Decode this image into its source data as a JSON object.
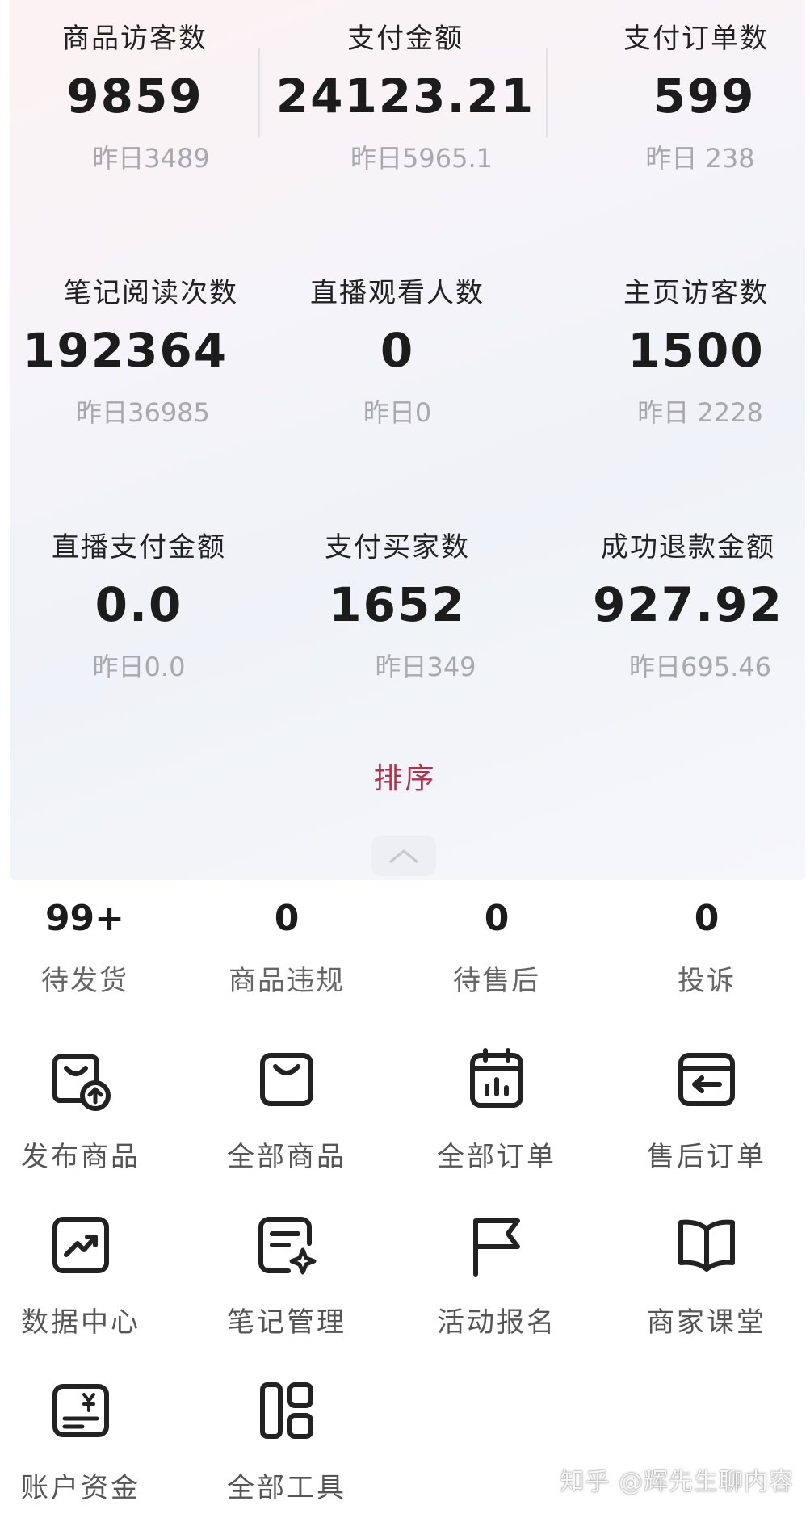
{
  "stats": [
    {
      "label": "商品访客数",
      "value": "9859",
      "yesterday": "昨日3489"
    },
    {
      "label": "支付金额",
      "value": "24123.21",
      "yesterday": "昨日5965.1"
    },
    {
      "label": "支付订单数",
      "value": "599",
      "yesterday": "昨日 238"
    },
    {
      "label": "笔记阅读次数",
      "value": "192364",
      "yesterday": "昨日36985"
    },
    {
      "label": "直播观看人数",
      "value": "0",
      "yesterday": "昨日0"
    },
    {
      "label": "主页访客数",
      "value": "1500",
      "yesterday": "昨日 2228"
    },
    {
      "label": "直播支付金额",
      "value": "0.0",
      "yesterday": "昨日0.0"
    },
    {
      "label": "支付买家数",
      "value": "1652",
      "yesterday": "昨日349"
    },
    {
      "label": "成功退款金额",
      "value": "927.92",
      "yesterday": "昨日695.46"
    }
  ],
  "sort_label": "排序",
  "todos": [
    {
      "count": "99+",
      "label": "待发货"
    },
    {
      "count": "0",
      "label": "商品违规"
    },
    {
      "count": "0",
      "label": "待售后"
    },
    {
      "count": "0",
      "label": "投诉"
    }
  ],
  "tools": [
    {
      "icon": "publish-product-icon",
      "label": "发布商品"
    },
    {
      "icon": "shopping-bag-icon",
      "label": "全部商品"
    },
    {
      "icon": "calendar-chart-icon",
      "label": "全部订单"
    },
    {
      "icon": "return-order-icon",
      "label": "售后订单"
    },
    {
      "icon": "trend-chart-icon",
      "label": "数据中心"
    },
    {
      "icon": "note-edit-icon",
      "label": "笔记管理"
    },
    {
      "icon": "flag-icon",
      "label": "活动报名"
    },
    {
      "icon": "book-icon",
      "label": "商家课堂"
    },
    {
      "icon": "wallet-yen-icon",
      "label": "账户资金"
    },
    {
      "icon": "grid-tools-icon",
      "label": "全部工具"
    }
  ],
  "watermark": "知乎 @辉先生聊内容",
  "accent_color": "#b0324c"
}
